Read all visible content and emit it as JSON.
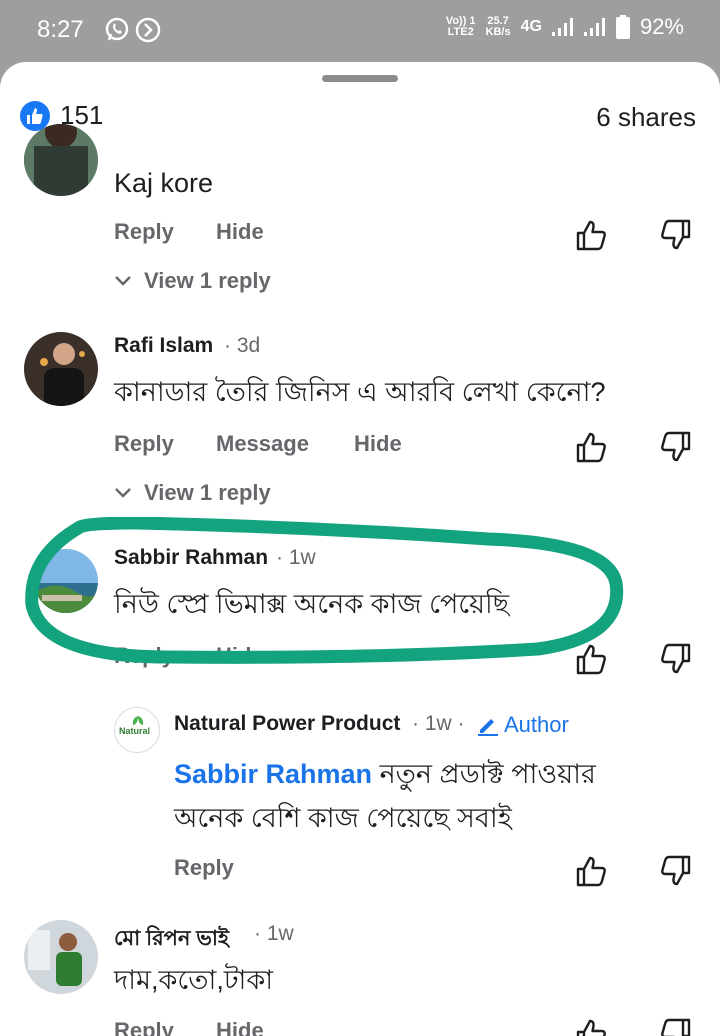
{
  "status_bar": {
    "time": "8:27",
    "volte_top": "Vo)) 1",
    "volte_bottom": "LTE2",
    "speed_value": "25.7",
    "speed_unit": "KB/s",
    "network": "4G",
    "battery": "92%"
  },
  "post": {
    "reaction_count": "151",
    "shares": "6 shares"
  },
  "comments": [
    {
      "text": "Kaj kore",
      "actions": [
        "Reply",
        "Hide"
      ],
      "view_replies": "View 1 reply"
    },
    {
      "name": "Rafi Islam",
      "time": "· 3d",
      "text": "কানাডার তৈরি জিনিস এ আরবি লেখা কেনো?",
      "actions": [
        "Reply",
        "Message",
        "Hide"
      ],
      "view_replies": "View 1 reply"
    },
    {
      "name": "Sabbir Rahman",
      "time": "· 1w",
      "text": "নিউ স্প্রে ভিমাক্স অনেক কাজ পেয়েছি",
      "actions": [
        "Reply",
        "Hide"
      ]
    },
    {
      "name": "Natural Power Product",
      "time": "· 1w ·",
      "badge": "Author",
      "avatar_text": "Natural",
      "mention": "Sabbir Rahman",
      "text_line1": "নতুন প্রডাক্ট পাওয়ার",
      "text_line2": "অনেক বেশি কাজ পেয়েছে সবাই",
      "actions": [
        "Reply"
      ]
    },
    {
      "name": "মো রিপন ভাই",
      "time": "· 1w",
      "text": "দাম,কতো,টাকা",
      "actions": [
        "Reply",
        "Hide"
      ]
    }
  ],
  "colors": {
    "accent": "#1a73e8",
    "like": "#1877f2",
    "highlight": "#14a37f"
  }
}
